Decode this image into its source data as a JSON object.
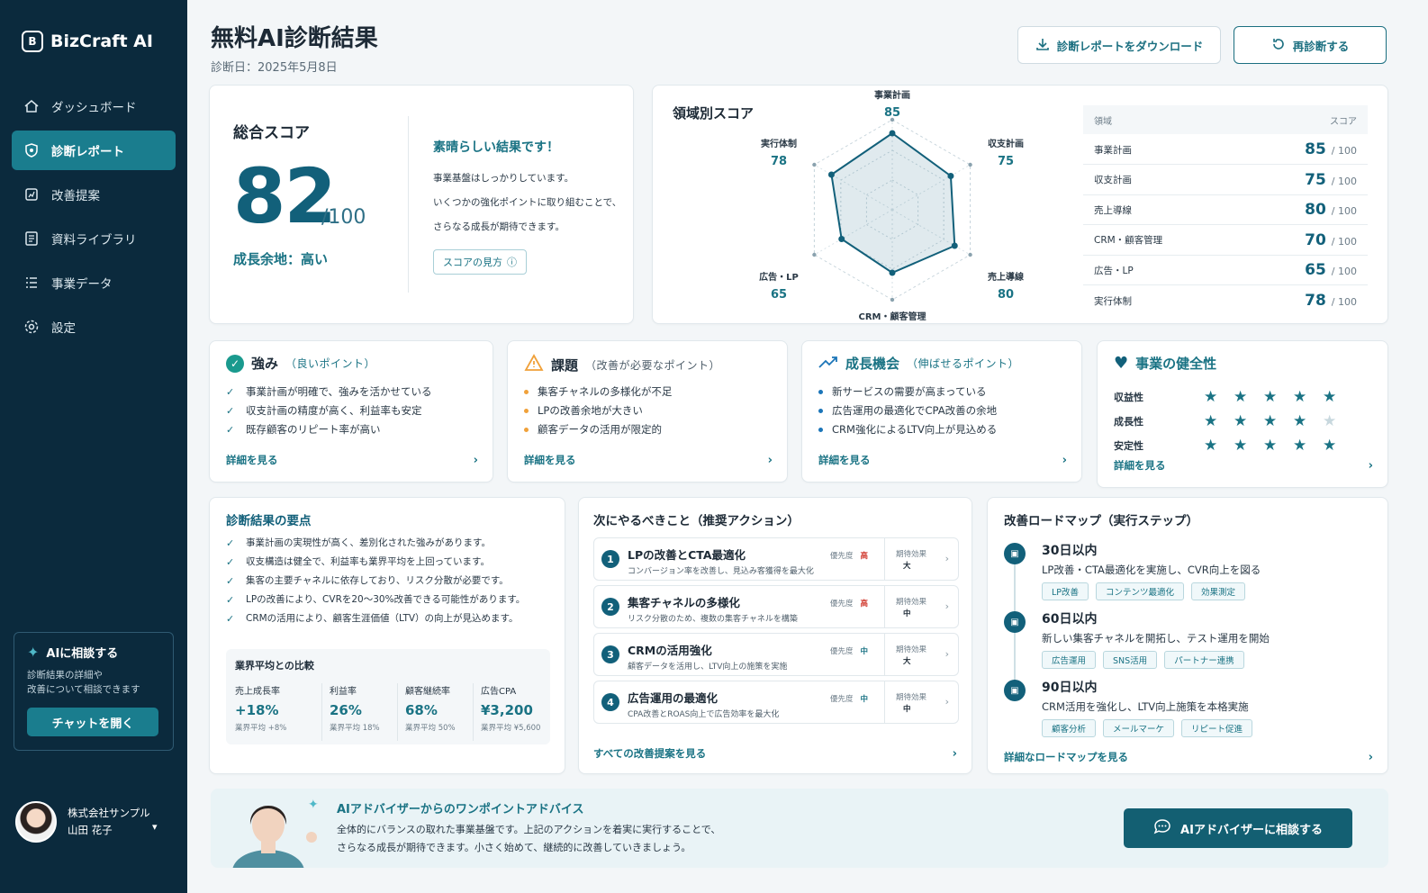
{
  "app": {
    "name": "BizCraft AI"
  },
  "sidebar": {
    "items": [
      {
        "label": "ダッシュボード",
        "icon": "home-icon"
      },
      {
        "label": "診断レポート",
        "icon": "shield-icon"
      },
      {
        "label": "改善提案",
        "icon": "chart-board-icon"
      },
      {
        "label": "資料ライブラリ",
        "icon": "document-icon"
      },
      {
        "label": "事業データ",
        "icon": "list-icon"
      },
      {
        "label": "設定",
        "icon": "gear-icon"
      }
    ],
    "active": "診断レポート",
    "ai_box": {
      "title": "AIに相談する",
      "desc_line1": "診断結果の詳細や",
      "desc_line2": "改善について相談できます",
      "button": "チャットを開く"
    },
    "user": {
      "company": "株式会社サンプル",
      "name": "山田 花子"
    }
  },
  "header": {
    "title": "無料AI診断結果",
    "date": "診断日：2025年5月8日",
    "download_label": "診断レポートをダウンロード",
    "rediagnose_label": "再診断する"
  },
  "overall": {
    "title": "総合スコア",
    "score": "82",
    "max": "/100",
    "growth": "成長余地：高い",
    "headline": "素晴らしい結果です！",
    "desc1": "事業基盤はしっかりしています。",
    "desc2": "いくつかの強化ポイントに取り組むことで、",
    "desc3": "さらなる成長が期待できます。",
    "help_label": "スコアの見方"
  },
  "areas": {
    "title": "領域別スコア",
    "col_area": "領域",
    "col_score": "スコア",
    "unit": "/ 100",
    "items": [
      {
        "name": "事業計画",
        "score": "85"
      },
      {
        "name": "収支計画",
        "score": "75"
      },
      {
        "name": "売上導線",
        "score": "80"
      },
      {
        "name": "CRM・顧客管理",
        "score": "70"
      },
      {
        "name": "広告・LP",
        "score": "65"
      },
      {
        "name": "実行体制",
        "score": "78"
      }
    ]
  },
  "chart_data": {
    "type": "radar",
    "categories": [
      "事業計画",
      "収支計画",
      "売上導線",
      "CRM・顧客管理",
      "広告・LP",
      "実行体制"
    ],
    "values": [
      85,
      75,
      80,
      70,
      65,
      78
    ],
    "ylim": [
      0,
      100
    ],
    "color": "#12607a"
  },
  "strengths": {
    "title": "強み",
    "subtitle": "（良いポイント）",
    "items": [
      "事業計画が明確で、強みを活かせている",
      "収支計画の精度が高く、利益率も安定",
      "既存顧客のリピート率が高い"
    ],
    "more": "詳細を見る"
  },
  "issues": {
    "title": "課題",
    "subtitle": "（改善が必要なポイント）",
    "items": [
      "集客チャネルの多様化が不足",
      "LPの改善余地が大きい",
      "顧客データの活用が限定的"
    ],
    "more": "詳細を見る"
  },
  "opportunities": {
    "title": "成長機会",
    "subtitle": "（伸ばせるポイント）",
    "items": [
      "新サービスの需要が高まっている",
      "広告運用の最適化でCPA改善の余地",
      "CRM強化によるLTV向上が見込める"
    ],
    "more": "詳細を見る"
  },
  "health": {
    "title": "事業の健全性",
    "rows": [
      {
        "label": "収益性",
        "stars": 5
      },
      {
        "label": "成長性",
        "stars": 4
      },
      {
        "label": "安定性",
        "stars": 5
      }
    ],
    "max_stars": 5,
    "more": "詳細を見る"
  },
  "summary": {
    "title": "診断結果の要点",
    "items": [
      "事業計画の実現性が高く、差別化された強みがあります。",
      "収支構造は健全で、利益率も業界平均を上回っています。",
      "集客の主要チャネルに依存しており、リスク分散が必要です。",
      "LPの改善により、CVRを20〜30%改善できる可能性があります。",
      "CRMの活用により、顧客生涯価値（LTV）の向上が見込めます。"
    ],
    "compare_title": "業界平均との比較",
    "kpis": [
      {
        "label": "売上成長率",
        "value": "+18%",
        "avg": "業界平均 +8%"
      },
      {
        "label": "利益率",
        "value": "26%",
        "avg": "業界平均 18%"
      },
      {
        "label": "顧客継続率",
        "value": "68%",
        "avg": "業界平均 50%"
      },
      {
        "label": "広告CPA",
        "value": "¥3,200",
        "avg": "業界平均 ¥5,600"
      }
    ]
  },
  "actions": {
    "title": "次にやるべきこと（推奨アクション）",
    "priority_label": "優先度",
    "effect_label": "期待効果",
    "items": [
      {
        "num": "1",
        "title": "LPの改善とCTA最適化",
        "desc": "コンバージョン率を改善し、見込み客獲得を最大化",
        "priority": "高",
        "effect": "大"
      },
      {
        "num": "2",
        "title": "集客チャネルの多様化",
        "desc": "リスク分散のため、複数の集客チャネルを構築",
        "priority": "高",
        "effect": "中"
      },
      {
        "num": "3",
        "title": "CRMの活用強化",
        "desc": "顧客データを活用し、LTV向上の施策を実施",
        "priority": "中",
        "effect": "大"
      },
      {
        "num": "4",
        "title": "広告運用の最適化",
        "desc": "CPA改善とROAS向上で広告効率を最大化",
        "priority": "中",
        "effect": "中"
      }
    ],
    "more": "すべての改善提案を見る"
  },
  "roadmap": {
    "title": "改善ロードマップ（実行ステップ）",
    "steps": [
      {
        "title": "30日以内",
        "desc": "LP改善・CTA最適化を実施し、CVR向上を図る",
        "tags": [
          "LP改善",
          "コンテンツ最適化",
          "効果測定"
        ]
      },
      {
        "title": "60日以内",
        "desc": "新しい集客チャネルを開拓し、テスト運用を開始",
        "tags": [
          "広告運用",
          "SNS活用",
          "パートナー連携"
        ]
      },
      {
        "title": "90日以内",
        "desc": "CRM活用を強化し、LTV向上施策を本格実施",
        "tags": [
          "顧客分析",
          "メールマーケ",
          "リピート促進"
        ]
      }
    ],
    "more": "詳細なロードマップを見る"
  },
  "advice": {
    "title": "AIアドバイザーからのワンポイントアドバイス",
    "line1": "全体的にバランスの取れた事業基盤です。上記のアクションを着実に実行することで、",
    "line2": "さらなる成長が期待できます。小さく始めて、継続的に改善していきましょう。",
    "button": "AIアドバイザーに相談する"
  }
}
